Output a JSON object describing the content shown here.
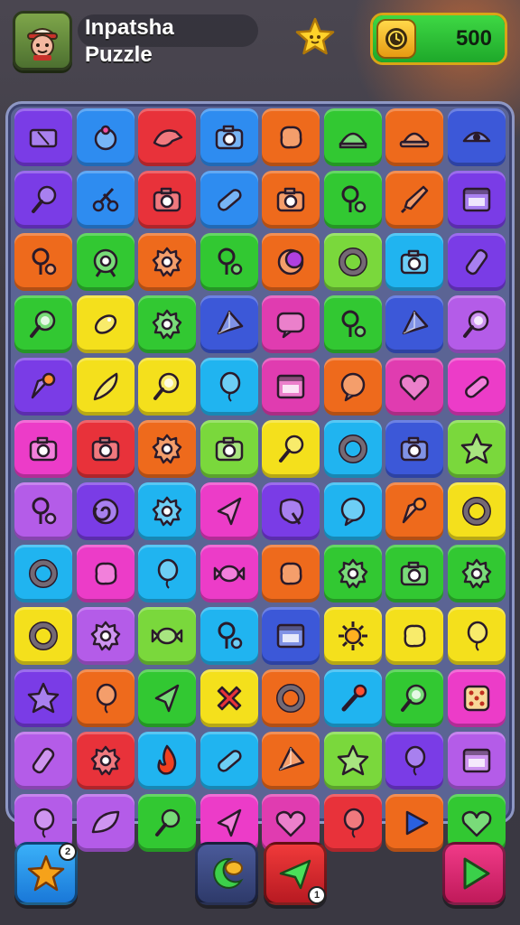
{
  "header": {
    "title_line1": "Inpatsha",
    "title_line2": "Puzzle",
    "coins": "500",
    "coin_fill_fraction": 1.0
  },
  "colors": {
    "blue": "#2e8cf0",
    "navy": "#3c58d8",
    "purple": "#7a3ce6",
    "red": "#e8323a",
    "orange": "#ee6a1c",
    "green": "#32c832",
    "lime": "#7ad83c",
    "yellow": "#f4e01c",
    "cyan": "#20b4f0",
    "pink": "#ec3cc8",
    "violet": "#b45ce8",
    "magenta": "#e03cb0"
  },
  "board": {
    "rows": [
      [
        "purple:ticket-icon",
        "blue:gem-bag-icon",
        "red:bird-icon",
        "blue:camera-icon",
        "orange:blob-icon",
        "green:dome-icon",
        "orange:hat-icon",
        "navy:eye-icon"
      ],
      [
        "purple:lollipop-icon",
        "blue:scissors-icon",
        "red:camera-icon",
        "blue:pill-icon",
        "orange:camera-icon",
        "green:key-icon",
        "orange:rocket-icon",
        "purple:window-icon"
      ],
      [
        "orange:key-icon",
        "green:target-icon",
        "orange:gear-icon",
        "green:key-icon",
        "orange:moon-icon",
        "lime:ring-icon",
        "cyan:camera-icon",
        "purple:bottle-icon"
      ],
      [
        "green:magnifier-icon",
        "yellow:fish-icon",
        "green:gear-icon",
        "navy:gem-icon",
        "magenta:chat-icon",
        "green:key-icon",
        "navy:gem-icon",
        "violet:magnifier-icon"
      ],
      [
        "purple:cone-icon",
        "yellow:feather-icon",
        "yellow:magnifier-icon",
        "cyan:balloon-icon",
        "magenta:window-icon",
        "orange:bubble-icon",
        "magenta:heart-icon",
        "pink:pill-icon"
      ],
      [
        "pink:camera-icon",
        "red:camera-icon",
        "orange:gear-icon",
        "lime:camera-icon",
        "yellow:lollipop-icon",
        "cyan:ring-icon",
        "navy:camera-icon",
        "lime:star-icon"
      ],
      [
        "violet:key-icon",
        "purple:swirl-icon",
        "cyan:gear-icon",
        "pink:kite-icon",
        "purple:splat-icon",
        "cyan:bubble-icon",
        "orange:cone-icon",
        "yellow:ring-icon"
      ],
      [
        "cyan:ring-icon",
        "pink:blob-icon",
        "cyan:balloon-icon",
        "pink:candy-icon",
        "orange:blob-icon",
        "green:gear-icon",
        "green:camera-icon",
        "green:gear-icon"
      ],
      [
        "yellow:ring-icon",
        "violet:gear-icon",
        "lime:candy-icon",
        "cyan:key-icon",
        "navy:window-icon",
        "yellow:sun-icon",
        "yellow:blob-icon",
        "yellow:balloon-icon"
      ],
      [
        "purple:star-icon",
        "orange:balloon-icon",
        "green:kite-icon",
        "yellow:cross-icon",
        "orange:ring-icon",
        "cyan:match-icon",
        "green:magnifier-icon",
        "pink:dice-icon"
      ],
      [
        "violet:bottle-icon",
        "red:gear-icon",
        "cyan:flame-icon",
        "cyan:pill-icon",
        "orange:gem-icon",
        "lime:star-icon",
        "purple:balloon-icon",
        "violet:window-icon"
      ],
      [
        "violet:balloon-icon",
        "violet:leaf-icon",
        "green:lollipop-icon",
        "pink:kite-icon",
        "magenta:heart-icon",
        "red:balloon-icon",
        "orange:play-icon",
        "green:heart-icon"
      ]
    ]
  },
  "bottom_buttons": {
    "star_badge": "2",
    "send_badge": "1"
  }
}
